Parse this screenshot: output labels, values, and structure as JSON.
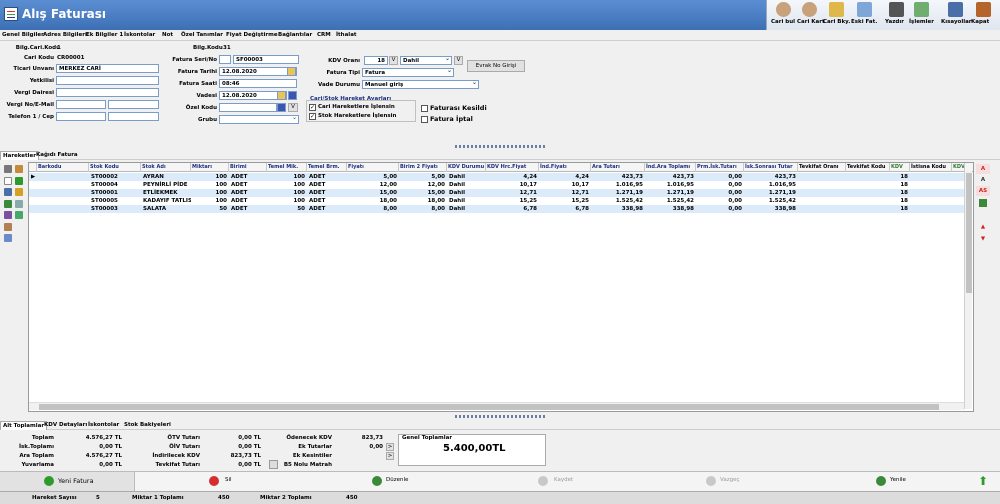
{
  "window": {
    "title": "Alış Faturası"
  },
  "toolbar": [
    {
      "label": "Cari bul",
      "icon": "person-search-icon"
    },
    {
      "label": "Cari Kart",
      "icon": "person-card-icon"
    },
    {
      "label": "Cari Bky.",
      "icon": "person-balance-icon"
    },
    {
      "label": "Eski Fat.",
      "icon": "old-invoice-icon"
    },
    {
      "label": "Yazdır",
      "icon": "printer-icon"
    },
    {
      "label": "İşlemler",
      "icon": "operations-icon"
    },
    {
      "label": "Kısayollar",
      "icon": "shortcuts-icon"
    },
    {
      "label": "Kapat",
      "icon": "close-door-icon"
    }
  ],
  "menu": [
    "Genel Bilgiler",
    "Adres Bilgileri",
    "Ek Bilgiler 1",
    "İskontolar",
    "Not",
    "Özel Tanımlar",
    "Fiyat Değiştirme",
    "Bağlantılar",
    "CRM",
    "İthalat"
  ],
  "form": {
    "bilg_cari_kodu_label": "Bilg.Cari.Kodu",
    "bilg_cari_kodu_value": "1",
    "cari_kodu_label": "Cari Kodu",
    "cari_kodu_value": "CR00001",
    "ticari_unvani_label": "Ticari Unvanı",
    "ticari_unvani_value": "MERKEZ CARİ",
    "yetkilisi_label": "Yetkilisi",
    "vergi_dairesi_label": "Vergi Dairesi",
    "vergi_no_label": "Vergi No/E-Mail",
    "telefon_label": "Telefon 1 / Cep",
    "bilg_kodu_label": "Bilg.Kodu",
    "bilg_kodu_value": "31",
    "fatura_serino_label": "Fatura Seri/No",
    "fatura_no_value": "SF00003",
    "fatura_tarihi_label": "Fatura Tarihi",
    "fatura_tarihi_value": "12.08.2020",
    "fatura_saati_label": "Fatura Saati",
    "fatura_saati_value": "08:46",
    "vadesi_label": "Vadesi",
    "vadesi_value": "12.08.2020",
    "ozel_kodu_label": "Özel Kodu",
    "grubu_label": "Grubu",
    "kdv_orani_label": "KDV Oranı",
    "kdv_orani_value": "18",
    "kdv_v_button": "V",
    "kdv_dahil_value": "Dahil",
    "kdv_v2_button": "V",
    "fatura_tipi_label": "Fatura Tipi",
    "fatura_tipi_value": "Fatura",
    "vade_durumu_label": "Vade Durumu",
    "vade_durumu_value": "Manuel giriş",
    "evrak_no_button": "Evrak No Girişi",
    "ozel_kodu_v_button": "V",
    "cari_stok_group_label": "Cari/Stok Hareket Ayarları",
    "cari_hareket_label": "Cari Hareketlere İşlensin",
    "stok_hareket_label": "Stok Hareketlere İşlensin",
    "fatura_kesildi_label": "Faturası Kesildi",
    "fatura_iptal_label": "Fatura İptal"
  },
  "tabs": [
    "Hareketler",
    "Kağıdı Fatura"
  ],
  "grid": {
    "columns": [
      "Barkodu",
      "Stok Kodu",
      "Stok Adı",
      "Miktarı",
      "Birimi",
      "Temel Mik.",
      "Temel Brm.",
      "Fiyatı",
      "Birim 2 Fiyatı",
      "KDV Durumu",
      "KDV Hrc.Fiyat",
      "İnd.Fiyatı",
      "Ara Tutarı",
      "İnd.Ara Toplamı",
      "Prm.İsk.Tutarı",
      "İsk.Sonrası Tutar",
      "Tevkifat Oranı",
      "Tevkifat Kodu",
      "KDV",
      "İstisna Kodu",
      "KDV"
    ],
    "rows": [
      [
        "",
        "ST00002",
        "AYRAN",
        "100",
        "ADET",
        "100",
        "ADET",
        "5,00",
        "5,00",
        "Dahil",
        "4,24",
        "4,24",
        "423,73",
        "423,73",
        "0,00",
        "423,73",
        "",
        "",
        "18",
        "",
        ""
      ],
      [
        "",
        "ST00004",
        "PEYNİRLİ PİDE",
        "100",
        "ADET",
        "100",
        "ADET",
        "12,00",
        "12,00",
        "Dahil",
        "10,17",
        "10,17",
        "1.016,95",
        "1.016,95",
        "0,00",
        "1.016,95",
        "",
        "",
        "18",
        "",
        ""
      ],
      [
        "",
        "ST00001",
        "ETLİEKMEK",
        "100",
        "ADET",
        "100",
        "ADET",
        "15,00",
        "15,00",
        "Dahil",
        "12,71",
        "12,71",
        "1.271,19",
        "1.271,19",
        "0,00",
        "1.271,19",
        "",
        "",
        "18",
        "",
        ""
      ],
      [
        "",
        "ST00005",
        "KADAYIF TATLIS",
        "100",
        "ADET",
        "100",
        "ADET",
        "18,00",
        "18,00",
        "Dahil",
        "15,25",
        "15,25",
        "1.525,42",
        "1.525,42",
        "0,00",
        "1.525,42",
        "",
        "",
        "18",
        "",
        ""
      ],
      [
        "",
        "ST00003",
        "SALATA",
        "50",
        "ADET",
        "50",
        "ADET",
        "8,00",
        "8,00",
        "Dahil",
        "6,78",
        "6,78",
        "338,98",
        "338,98",
        "0,00",
        "338,98",
        "",
        "",
        "18",
        "",
        ""
      ]
    ]
  },
  "right_buttons": [
    "A",
    "A",
    "AS",
    "",
    "",
    ""
  ],
  "bottom_tabs": [
    "Alt Toplamlar",
    "KDV Detayları",
    "İskontolar",
    "Stok Bakiyeleri"
  ],
  "totals": {
    "toplam_label": "Toplam",
    "toplam_value": "4.576,27 TL",
    "isk_toplami_label": "İsk.Toplamı",
    "isk_toplami_value": "0,00 TL",
    "ara_toplam_label": "Ara Toplam",
    "ara_toplam_value": "4.576,27 TL",
    "yuvarlama_label": "Yuvarlama",
    "yuvarlama_value": "0,00 TL",
    "otv_tutari_label": "ÖTV Tutarı",
    "otv_tutari_value": "0,00 TL",
    "oiv_tutari_label": "ÖİV Tutarı",
    "oiv_tutari_value": "0,00 TL",
    "indirilecek_kdv_label": "İndirilecek KDV",
    "indirilecek_kdv_value": "823,73 TL",
    "tevkifat_tutari_label": "Tevkifat Tutarı",
    "tevkifat_tutari_value": "0,00 TL",
    "odenecek_kdv_label": "Ödenecek KDV",
    "odenecek_kdv_value": "823,73",
    "ek_tutarlar_label": "Ek Tutarlar",
    "ek_tutarlar_value": "0,00",
    "ek_kesintiler_label": "Ek Kesintiler",
    "bs_nolu_label": "B5 Nolu Matrah",
    "genel_toplamlar_label": "Genel Toplamlar",
    "genel_toplamlar_value": "5.400,00TL"
  },
  "actions": [
    "Yeni Fatura",
    "Sil",
    "Düzenle",
    "Kaydet",
    "Vazgeç",
    "Yenile"
  ],
  "status": {
    "hareket_sayisi_label": "Hareket Sayısı",
    "hareket_sayisi_value": "5",
    "miktar1_label": "Miktar 1 Toplamı",
    "miktar1_value": "450",
    "miktar2_label": "Miktar 2 Toplamı",
    "miktar2_value": "450"
  },
  "colors": {
    "title_bar": "#4a7fc4",
    "selected_row": "#dcebf9",
    "accent_green": "#2e9a2e",
    "accent_red": "#d32f2f"
  }
}
